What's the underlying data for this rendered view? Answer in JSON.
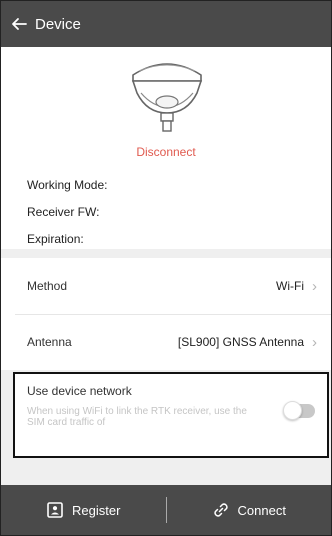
{
  "header": {
    "title": "Device"
  },
  "device": {
    "status": "Disconnect",
    "status_color": "#e05a4f",
    "info": [
      {
        "label": "Working Mode:"
      },
      {
        "label": "Receiver FW:"
      },
      {
        "label": "Expiration:"
      }
    ]
  },
  "settings": {
    "method": {
      "label": "Method",
      "value": "Wi-Fi"
    },
    "antenna": {
      "label": "Antenna",
      "value": "[SL900] GNSS Antenna"
    }
  },
  "network": {
    "title": "Use device network",
    "description": "When using WiFi to link the RTK receiver, use the SIM card traffic of",
    "enabled": false
  },
  "footer": {
    "register_label": "Register",
    "connect_label": "Connect"
  },
  "colors": {
    "header_bg": "#4a4a4a",
    "accent_red": "#e05a4f"
  },
  "icons": [
    "back-arrow-icon",
    "receiver-icon",
    "chevron-right-icon",
    "register-icon",
    "link-icon"
  ]
}
